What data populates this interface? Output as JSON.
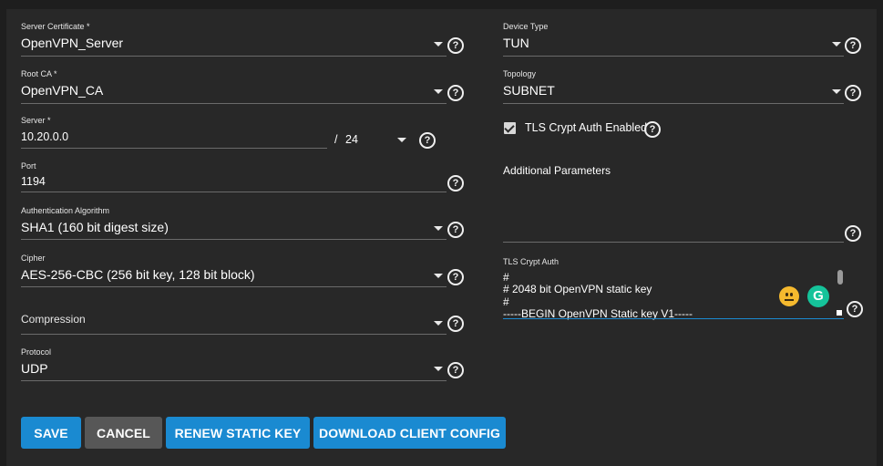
{
  "left": {
    "server_certificate": {
      "label": "Server Certificate *",
      "value": "OpenVPN_Server"
    },
    "root_ca": {
      "label": "Root CA *",
      "value": "OpenVPN_CA"
    },
    "server": {
      "label": "Server *",
      "value": "10.20.0.0",
      "separator": "/",
      "netmask": "24"
    },
    "port": {
      "label": "Port",
      "value": "1194"
    },
    "auth_algorithm": {
      "label": "Authentication Algorithm",
      "value": "SHA1 (160 bit digest size)"
    },
    "cipher": {
      "label": "Cipher",
      "value": "AES-256-CBC (256 bit key, 128 bit block)"
    },
    "compression": {
      "label": "Compression",
      "value": ""
    },
    "protocol": {
      "label": "Protocol",
      "value": "UDP"
    }
  },
  "right": {
    "device_type": {
      "label": "Device Type",
      "value": "TUN"
    },
    "topology": {
      "label": "Topology",
      "value": "SUBNET"
    },
    "tls_crypt_enabled": {
      "label": "TLS Crypt Auth Enabled",
      "checked": true
    },
    "additional_params": {
      "label": "Additional Parameters",
      "value": ""
    },
    "tls_crypt_auth": {
      "label": "TLS Crypt Auth",
      "lines": [
        "#",
        "# 2048 bit OpenVPN static key",
        "#",
        "-----BEGIN OpenVPN Static key V1-----"
      ]
    }
  },
  "help_glyph": "?",
  "grammarly_glyph": "G",
  "buttons": {
    "save": "SAVE",
    "cancel": "CANCEL",
    "renew": "RENEW STATIC KEY",
    "download": "DOWNLOAD CLIENT CONFIG"
  },
  "colors": {
    "background": "#1e1e1e",
    "panel": "#282828",
    "primary_button": "#1a8ad1",
    "secondary_button": "#575757",
    "underline": "#6b6b6b"
  }
}
